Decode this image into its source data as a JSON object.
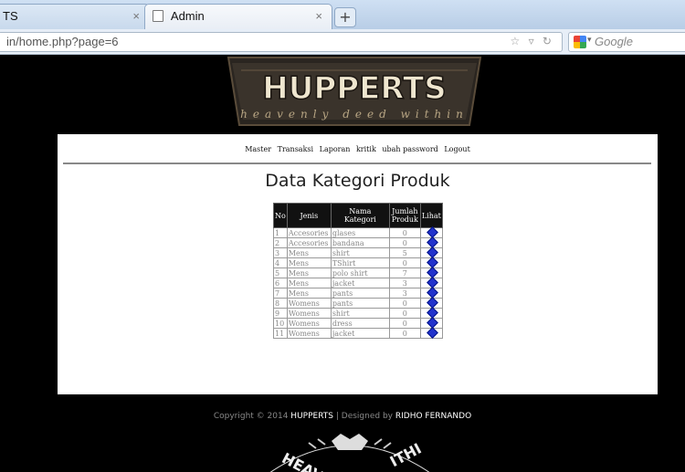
{
  "browser": {
    "inactive_tab_title": "TS",
    "active_tab_title": "Admin",
    "tab_close": "×",
    "new_tab": "+",
    "url": "in/home.php?page=6",
    "search_placeholder": "Google"
  },
  "logo": {
    "title": "HUPPERTS",
    "tagline": "heavenly deed within"
  },
  "menu": {
    "items": [
      "Master",
      "Transaksi",
      "Laporan",
      "kritik",
      "ubah password",
      "Logout"
    ]
  },
  "page": {
    "heading": "Data Kategori Produk"
  },
  "table": {
    "headers": {
      "no": "No",
      "jenis": "Jenis",
      "nama": "Nama Kategori",
      "jumlah": "Jumlah Produk",
      "lihat": "Lihat"
    },
    "rows": [
      {
        "no": "1",
        "jenis": "Accesories",
        "nama": "glases",
        "jumlah": "0"
      },
      {
        "no": "2",
        "jenis": "Accesories",
        "nama": "bandana",
        "jumlah": "0"
      },
      {
        "no": "3",
        "jenis": "Mens",
        "nama": "shirt",
        "jumlah": "5"
      },
      {
        "no": "4",
        "jenis": "Mens",
        "nama": "TShirt",
        "jumlah": "0"
      },
      {
        "no": "5",
        "jenis": "Mens",
        "nama": "polo shirt",
        "jumlah": "7"
      },
      {
        "no": "6",
        "jenis": "Mens",
        "nama": "jacket",
        "jumlah": "3"
      },
      {
        "no": "7",
        "jenis": "Mens",
        "nama": "pants",
        "jumlah": "3"
      },
      {
        "no": "8",
        "jenis": "Womens",
        "nama": "pants",
        "jumlah": "0"
      },
      {
        "no": "9",
        "jenis": "Womens",
        "nama": "shirt",
        "jumlah": "0"
      },
      {
        "no": "10",
        "jenis": "Womens",
        "nama": "dress",
        "jumlah": "0"
      },
      {
        "no": "11",
        "jenis": "Womens",
        "nama": "jacket",
        "jumlah": "0"
      }
    ]
  },
  "footer": {
    "prefix": "Copyright © 2014 ",
    "brand": "HUPPERTS",
    "middle": " | Designed by ",
    "author": "RIDHO FERNANDO"
  },
  "badge": {
    "text_left": "HEAV",
    "text_right": "ITHI"
  },
  "colors": {
    "page_bg": "#000000",
    "panel_bg": "#ffffff",
    "table_header_bg": "#111111",
    "view_icon": "#2233cc"
  }
}
